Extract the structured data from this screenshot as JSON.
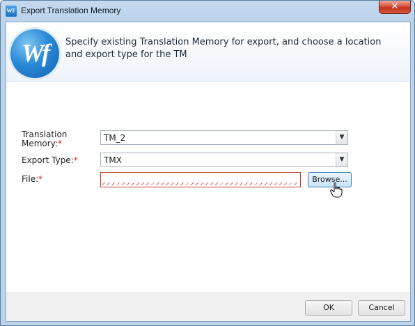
{
  "window": {
    "title": "Export Translation Memory",
    "close_glyph": "✕",
    "app_icon_text": "WF"
  },
  "header": {
    "logo_text": "Wf",
    "description": "Specify existing Translation Memory for export, and choose a location and export type for the TM"
  },
  "form": {
    "translation_memory": {
      "label": "Translation Memory:",
      "required_mark": "*",
      "value": "TM_2"
    },
    "export_type": {
      "label": "Export Type:",
      "required_mark": "*",
      "value": "TMX"
    },
    "file": {
      "label": "File:",
      "required_mark": "*",
      "value": "",
      "browse_label": "Browse..."
    }
  },
  "footer": {
    "ok_label": "OK",
    "cancel_label": "Cancel"
  },
  "icons": {
    "dropdown": "chevron-down-icon",
    "cursor": "hand-pointer-icon"
  },
  "colors": {
    "accent": "#2a8ad6",
    "required": "#d11f1f",
    "error_border": "#c03a2b"
  }
}
